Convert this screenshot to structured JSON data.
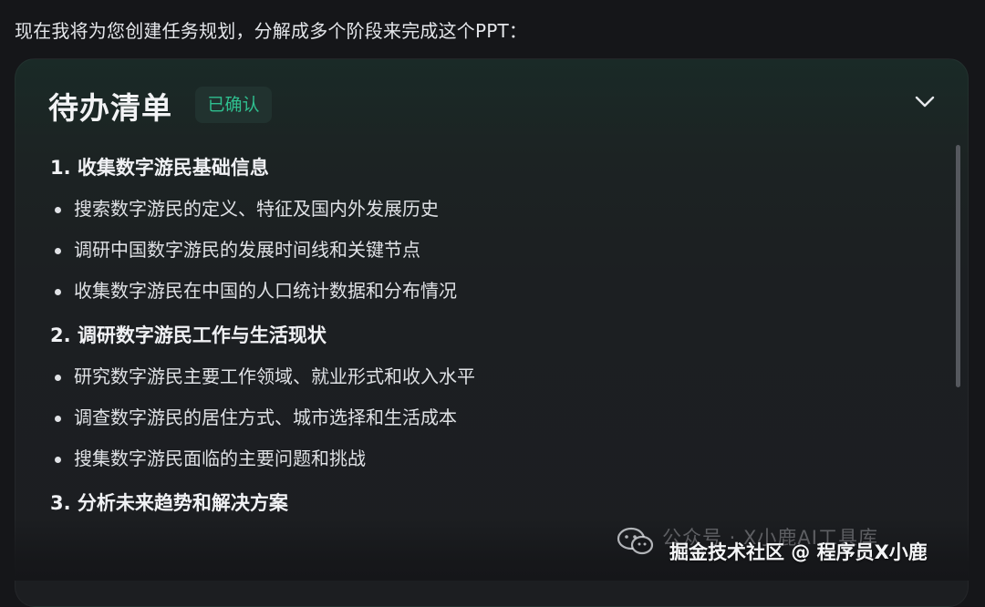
{
  "intro_text": "现在我将为您创建任务规划，分解成多个阶段来完成这个PPT：",
  "card": {
    "title": "待办清单",
    "badge": "已确认",
    "badge_color": "#2fbf8f",
    "collapse_icon": "chevron-down-icon"
  },
  "sections": [
    {
      "title": "1. 收集数字游民基础信息",
      "items": [
        "搜索数字游民的定义、特征及国内外发展历史",
        "调研中国数字游民的发展时间线和关键节点",
        "收集数字游民在中国的人口统计数据和分布情况"
      ]
    },
    {
      "title": "2. 调研数字游民工作与生活现状",
      "items": [
        "研究数字游民主要工作领域、就业形式和收入水平",
        "调查数字游民的居住方式、城市选择和生活成本",
        "搜集数字游民面临的主要问题和挑战"
      ]
    },
    {
      "title": "3. 分析未来趋势和解决方案",
      "items": []
    }
  ],
  "watermark": {
    "faint_text": "公众号 · X小鹿AI工具库",
    "main_text": "掘金技术社区 @ 程序员X小鹿",
    "icon": "wechat-icon"
  }
}
